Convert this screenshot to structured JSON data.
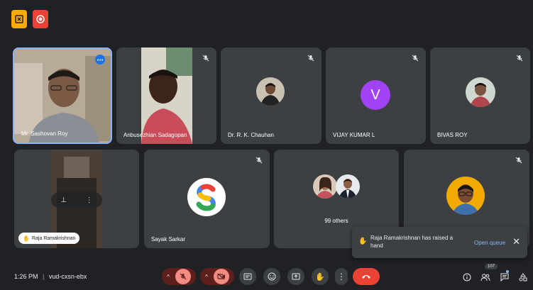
{
  "participants": {
    "p1": "Mr. Sashovan Roy",
    "p2": "Anbusezhian Sadagopan",
    "p3": "Dr. R. K. Chauhan",
    "p4": "VIJAY KUMAR L",
    "p4_initial": "V",
    "p5": "BIVAS ROY",
    "p6": "Raja Ramakrishnan",
    "p7": "Sayak Sarkar",
    "p8": "99 others"
  },
  "notification": {
    "message": "Raja Ramakrishnan has raised a hand",
    "action": "Open queue",
    "close": "✕"
  },
  "meeting": {
    "time": "1:26 PM",
    "separator": "|",
    "code": "vud-cxsn-ebx",
    "participant_count": "107"
  },
  "colors": {
    "background": "#202124",
    "tile": "#3c4043",
    "avatar_purple": "#a142f4",
    "end_call_red": "#ea4335",
    "link_blue": "#8ab4f8"
  },
  "icons": [
    "mic-off-icon",
    "camera-off-icon",
    "captions-icon",
    "emoji-icon",
    "present-icon",
    "raise-hand-icon",
    "more-options-icon",
    "end-call-icon",
    "info-icon",
    "people-icon",
    "chat-icon",
    "activities-icon"
  ]
}
